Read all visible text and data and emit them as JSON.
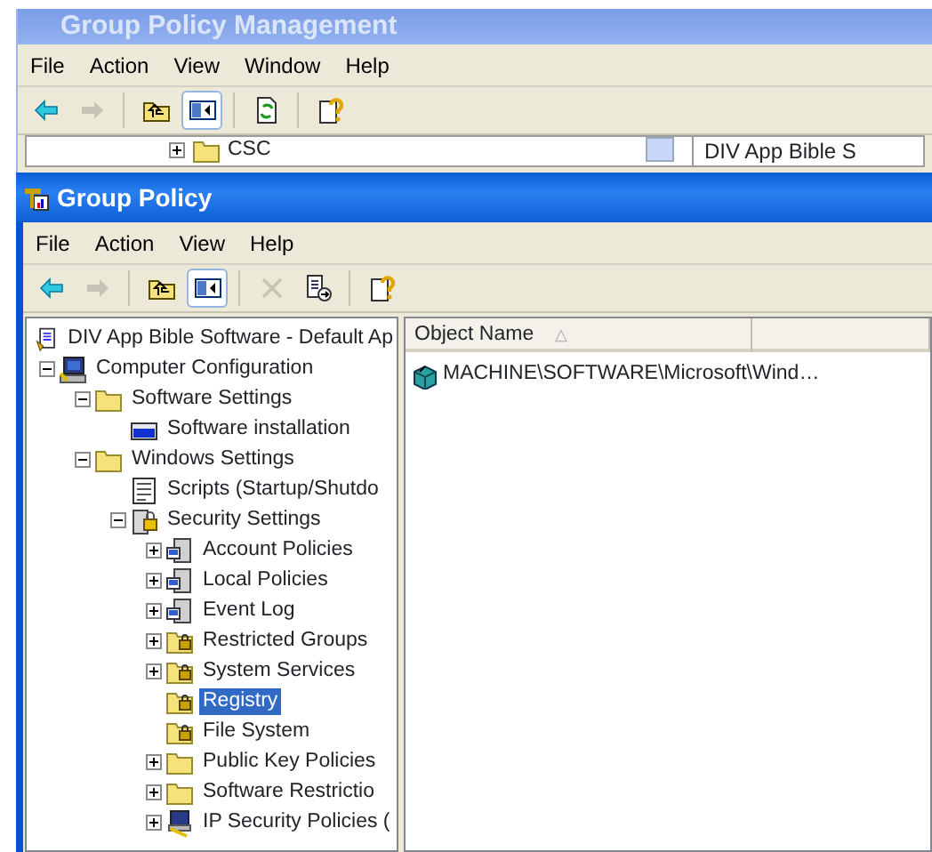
{
  "background_window": {
    "title": "Group Policy Management",
    "menu": [
      "File",
      "Action",
      "View",
      "Window",
      "Help"
    ],
    "toolbar": [
      {
        "kind": "back",
        "disabled": false
      },
      {
        "kind": "forward",
        "disabled": true
      },
      {
        "kind": "separator"
      },
      {
        "kind": "up",
        "disabled": false
      },
      {
        "kind": "tree",
        "disabled": false,
        "pressed": true
      },
      {
        "kind": "separator"
      },
      {
        "kind": "refresh",
        "disabled": false
      },
      {
        "kind": "separator"
      },
      {
        "kind": "help",
        "disabled": false
      }
    ],
    "tree_item": {
      "label": "CSC",
      "expanded": false
    },
    "detail_title": "DIV App Bible S"
  },
  "window": {
    "title": "Group Policy",
    "menu": [
      "File",
      "Action",
      "View",
      "Help"
    ],
    "toolbar": [
      {
        "kind": "back",
        "disabled": false
      },
      {
        "kind": "forward",
        "disabled": true
      },
      {
        "kind": "separator"
      },
      {
        "kind": "up",
        "disabled": false
      },
      {
        "kind": "tree",
        "disabled": false,
        "pressed": true
      },
      {
        "kind": "separator"
      },
      {
        "kind": "delete",
        "disabled": true
      },
      {
        "kind": "export",
        "disabled": false
      },
      {
        "kind": "separator"
      },
      {
        "kind": "help",
        "disabled": false
      }
    ],
    "tree": [
      {
        "label": "DIV App Bible Software - Default Ap",
        "kind": "policy",
        "selected": false,
        "children": [
          {
            "label": "Computer Configuration",
            "kind": "computer",
            "selected": false,
            "expanded": true,
            "children": [
              {
                "label": "Software Settings",
                "kind": "folder",
                "selected": false,
                "expanded": true,
                "children": [
                  {
                    "label": "Software installation",
                    "kind": "package",
                    "selected": false
                  }
                ]
              },
              {
                "label": "Windows Settings",
                "kind": "folder",
                "selected": false,
                "expanded": true,
                "children": [
                  {
                    "label": "Scripts (Startup/Shutdo",
                    "kind": "script",
                    "selected": false
                  },
                  {
                    "label": "Security Settings",
                    "kind": "security",
                    "selected": false,
                    "expanded": true,
                    "children": [
                      {
                        "label": "Account Policies",
                        "kind": "server",
                        "selected": false,
                        "expanded": false
                      },
                      {
                        "label": "Local Policies",
                        "kind": "server",
                        "selected": false,
                        "expanded": false
                      },
                      {
                        "label": "Event Log",
                        "kind": "server",
                        "selected": false,
                        "expanded": false
                      },
                      {
                        "label": "Restricted Groups",
                        "kind": "lockfolder",
                        "selected": false,
                        "expanded": false
                      },
                      {
                        "label": "System Services",
                        "kind": "lockfolder",
                        "selected": false,
                        "expanded": false
                      },
                      {
                        "label": "Registry",
                        "kind": "lockfolder",
                        "selected": true
                      },
                      {
                        "label": "File System",
                        "kind": "lockfolder",
                        "selected": false
                      },
                      {
                        "label": "Public Key Policies",
                        "kind": "folder",
                        "selected": false,
                        "expanded": false
                      },
                      {
                        "label": "Software Restrictio",
                        "kind": "folder",
                        "selected": false,
                        "expanded": false
                      },
                      {
                        "label": "IP Security Policies (",
                        "kind": "ipsec",
                        "selected": false,
                        "expanded": false
                      }
                    ]
                  }
                ]
              }
            ]
          }
        ]
      }
    ],
    "list": {
      "columns": [
        {
          "label": "Object Name",
          "sort_mark": "△"
        },
        {}
      ],
      "rows": [
        {
          "label": "MACHINE\\SOFTWARE\\Microsoft\\Wind…"
        }
      ]
    }
  }
}
